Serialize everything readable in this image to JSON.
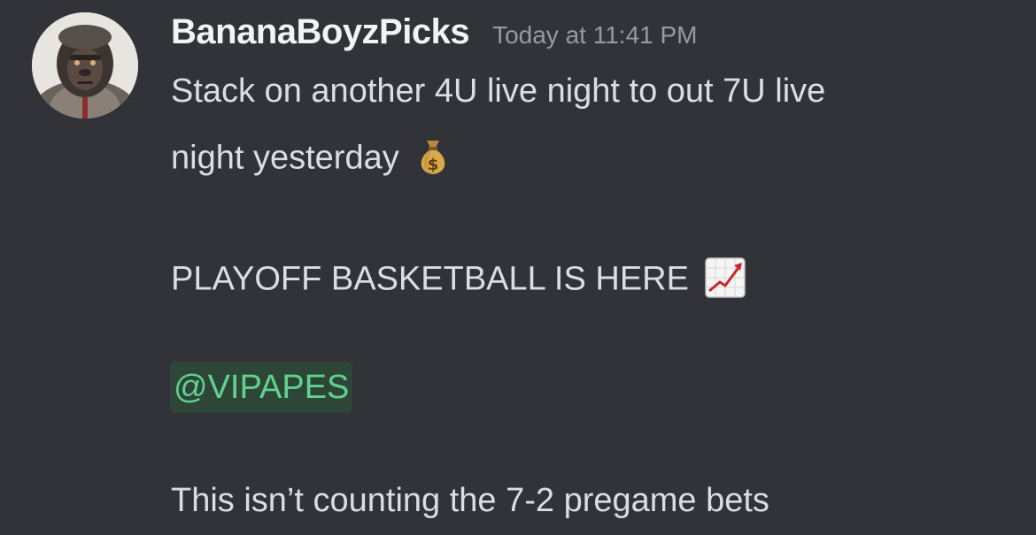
{
  "message": {
    "username": "BananaBoyzPicks",
    "timestamp": "Today at 11:41 PM",
    "lines": [
      "Stack on another 4U live night to out 7U live",
      "night yesterday",
      "PLAYOFF BASKETBALL IS HERE",
      "@VIPAPES",
      "This isn’t counting the 7-2 pregame bets"
    ],
    "mention_role": "@VIPAPES",
    "emojis": {
      "line2": "money-bag-icon",
      "line3": "chart-increasing-icon"
    }
  },
  "colors": {
    "background": "#313338",
    "username": "#f2f3f5",
    "timestamp": "#949ba4",
    "text": "#dbdee1",
    "mention_text": "#5fd28d",
    "mention_bg": "#2e4638"
  }
}
